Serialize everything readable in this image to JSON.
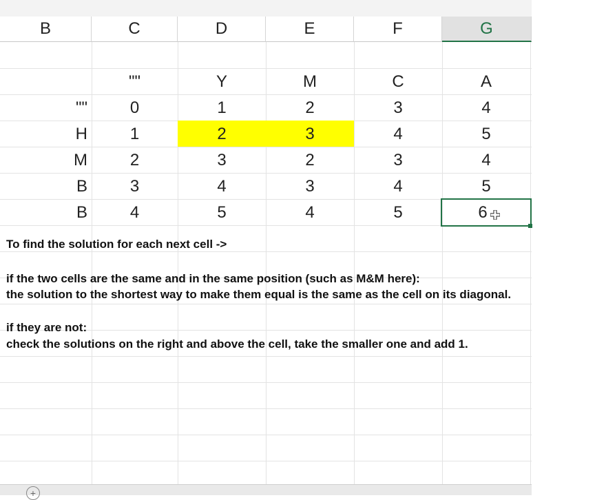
{
  "columns": [
    "B",
    "C",
    "D",
    "E",
    "F",
    "G"
  ],
  "selected_column": "G",
  "table": {
    "header_row": [
      "",
      "\"\"",
      "Y",
      "M",
      "C",
      "A"
    ],
    "rows": [
      {
        "label": "\"\"",
        "values": [
          "0",
          "1",
          "2",
          "3",
          "4"
        ]
      },
      {
        "label": "H",
        "values": [
          "1",
          "2",
          "3",
          "4",
          "5"
        ]
      },
      {
        "label": "M",
        "values": [
          "2",
          "3",
          "2",
          "3",
          "4"
        ]
      },
      {
        "label": "B",
        "values": [
          "3",
          "4",
          "3",
          "4",
          "5"
        ]
      },
      {
        "label": "B",
        "values": [
          "4",
          "5",
          "4",
          "5",
          "6"
        ]
      }
    ]
  },
  "highlight_color": "#ffff00",
  "selection_color": "#217346",
  "notes": {
    "line1": "To find the solution for each next cell ->",
    "line2": "if the two cells are the same and in the same position (such as M&M here):",
    "line3": "the solution to the shortest way to make them equal is the same as the cell on its diagonal.",
    "line4": "if they are not:",
    "line5": "check the solutions on the right and above the cell, take the smaller one and add 1."
  },
  "icons": {
    "add_sheet": "plus-circle-icon",
    "cursor": "cell-select-cursor-icon"
  },
  "add_sheet_symbol": "+"
}
